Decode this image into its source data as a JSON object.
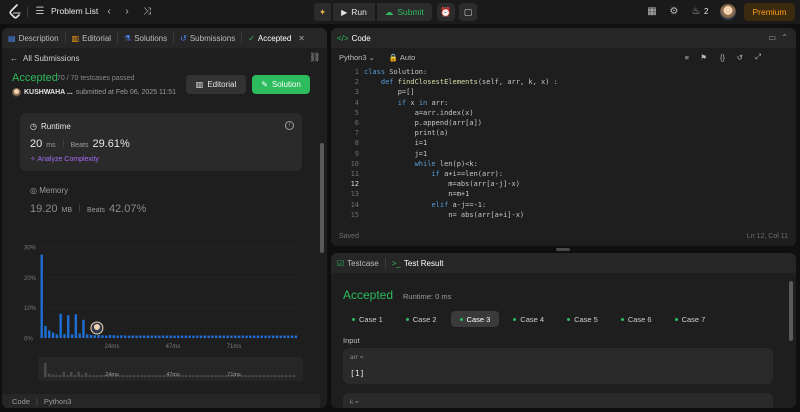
{
  "topbar": {
    "title": "Problem List",
    "run_label": "Run",
    "submit_label": "Submit",
    "streak_count": "2",
    "premium_label": "Premium"
  },
  "left_tabs": {
    "description": "Description",
    "editorial": "Editorial",
    "solutions": "Solutions",
    "submissions": "Submissions",
    "accepted": "Accepted"
  },
  "submission": {
    "back_label": "All Submissions",
    "status": "Accepted",
    "passed": "70 / 70 testcases passed",
    "user": "KUSHWAHA ...",
    "submitted_at": "submitted at Feb 06, 2025 11:51",
    "editorial_btn": "Editorial",
    "solution_btn": "Solution"
  },
  "runtime": {
    "title": "Runtime",
    "value": "20",
    "unit": "ms",
    "beats_label": "Beats",
    "beats": "29.61%",
    "analyze": "Analyze Complexity"
  },
  "memory": {
    "title": "Memory",
    "value": "19.20",
    "unit": "MB",
    "beats_label": "Beats",
    "beats": "42.07%"
  },
  "footer": {
    "code_label": "Code",
    "lang": "Python3"
  },
  "chart_data": {
    "type": "bar",
    "ylim": [
      0,
      30
    ],
    "yticks": [
      "30%",
      "20%",
      "10%",
      "0%"
    ],
    "xticks": [
      "24ms",
      "47ms",
      "71ms"
    ],
    "values": [
      27.5,
      4.0,
      2.5,
      1.8,
      1.2,
      8.0,
      1.3,
      7.5,
      1.2,
      7.8,
      1.5,
      6.0,
      1.2,
      1.0,
      0.9,
      1.0,
      0.9,
      0.8,
      1.0,
      0.9,
      0.8,
      0.9,
      0.8,
      0.8,
      0.8,
      0.8,
      0.8,
      0.8,
      0.8,
      0.8,
      0.8,
      0.8,
      0.8,
      0.8,
      0.8,
      0.8,
      0.8,
      0.8,
      0.8,
      0.8,
      0.8,
      0.8,
      0.8,
      0.8,
      0.8,
      0.8,
      0.8,
      0.8,
      0.8,
      0.8,
      0.8,
      0.8,
      0.8,
      0.8,
      0.8,
      0.8,
      0.8,
      0.8,
      0.8,
      0.8,
      0.8,
      0.8,
      0.8,
      0.8,
      0.8,
      0.8,
      0.8,
      0.8
    ],
    "bar_color": "#1d6fd6"
  },
  "code_panel": {
    "tab": "Code",
    "language": "Python3",
    "mode": "Auto",
    "status": "Saved",
    "cursor": "Ln 12, Col 11",
    "lines": [
      "class Solution:",
      "    def findClosestElements(self, arr, k, x) :",
      "        p=[]",
      "        if x in arr:",
      "            a=arr.index(x)",
      "            p.append(arr[a])",
      "            print(a)",
      "            i=1",
      "            j=1",
      "            while len(p)<k:",
      "                if a+i==len(arr):",
      "                    m=abs(arr[a-j]-x)",
      "                    n=m+1",
      "                elif a-j==-1:",
      "                    n= abs(arr[a+i]-x)"
    ],
    "current_line": 12
  },
  "test_panel": {
    "testcase_tab": "Testcase",
    "result_tab": "Test Result",
    "status": "Accepted",
    "runtime": "Runtime: 0 ms",
    "cases": [
      "Case 1",
      "Case 2",
      "Case 3",
      "Case 4",
      "Case 5",
      "Case 6",
      "Case 7"
    ],
    "selected_case": 2,
    "input_label": "Input",
    "inputs": [
      {
        "label": "arr =",
        "value": "[1]"
      },
      {
        "label": "k =",
        "value": ""
      }
    ]
  },
  "colors": {
    "accent_green": "#2cbb5d",
    "premium": "#ffa116",
    "bar_blue": "#1d6fd6"
  }
}
